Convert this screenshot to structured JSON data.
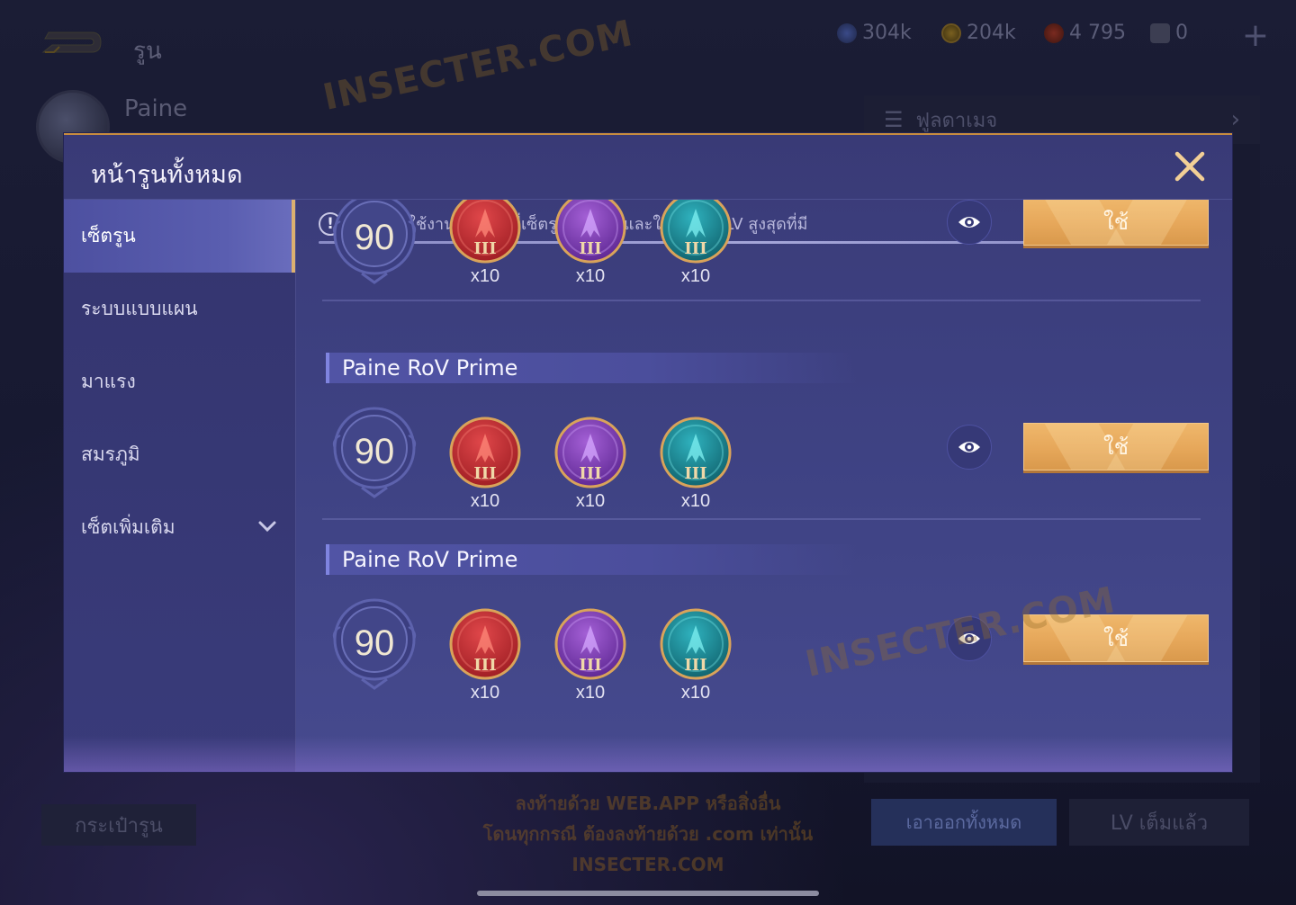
{
  "topbar": {
    "page_label": "รูน",
    "currencies": [
      {
        "icon": "blue-crystal-icon",
        "value": "304k"
      },
      {
        "icon": "gold-coin-icon",
        "value": "204k"
      },
      {
        "icon": "red-essence-icon",
        "value": "4 795"
      },
      {
        "icon": "rune-card-icon",
        "value": "0"
      }
    ],
    "plus_label": "+"
  },
  "hero": {
    "name": "Paine"
  },
  "right_panel": {
    "header_label": "ฟูลดาเมจ"
  },
  "bottom": {
    "left_button": "กระเป๋ารูน",
    "notice_lines": [
      "ลงท้ายด้วย WEB.APP หรือสิ่งอื่น",
      "โดนทุกกรณี ต้องลงท้ายด้วย .com เท่านั้น",
      "INSECTER.COM"
    ],
    "remove_all_button": "เอาออกทั้งหมด",
    "lv_full_button": "LV เต็มแล้ว"
  },
  "watermarks": [
    "INSECTER.COM",
    "INSECTER.COM"
  ],
  "modal": {
    "title": "หน้ารูนทั้งหมด",
    "close_icon": "close-icon",
    "sidebar": [
      {
        "label": "เซ็ตรูน",
        "active": true
      },
      {
        "label": "ระบบแบบแผน",
        "active": false
      },
      {
        "label": "มาแรง",
        "active": false
      },
      {
        "label": "สมรภูมิ",
        "active": false
      },
      {
        "label": "เซ็ตเพิ่มเติม",
        "active": false,
        "expandable": true
      }
    ],
    "notice": "หลังจากใช้งาน จะแทนที่เซ็ตรูนปัจจุบัน และใช้งานรูน LV สูงสุดที่มี",
    "rune_sets": [
      {
        "name": "",
        "level": "90",
        "runes": [
          {
            "color": "red",
            "tier": "III",
            "count": "x10"
          },
          {
            "color": "purple",
            "tier": "III",
            "count": "x10"
          },
          {
            "color": "teal",
            "tier": "III",
            "count": "x10"
          }
        ],
        "use_label": "ใช้"
      },
      {
        "name": "Paine RoV Prime",
        "level": "90",
        "runes": [
          {
            "color": "red",
            "tier": "III",
            "count": "x10"
          },
          {
            "color": "purple",
            "tier": "III",
            "count": "x10"
          },
          {
            "color": "teal",
            "tier": "III",
            "count": "x10"
          }
        ],
        "use_label": "ใช้"
      },
      {
        "name": "Paine RoV Prime",
        "level": "90",
        "runes": [
          {
            "color": "red",
            "tier": "III",
            "count": "x10"
          },
          {
            "color": "purple",
            "tier": "III",
            "count": "x10"
          },
          {
            "color": "teal",
            "tier": "III",
            "count": "x10"
          }
        ],
        "use_label": "ใช้"
      }
    ]
  },
  "colors": {
    "accent_gold": "#e6a75a",
    "modal_bg": "#3e4283",
    "rune_red": "#c0282a",
    "rune_purple": "#7a3aa8",
    "rune_teal": "#1a8a96"
  }
}
